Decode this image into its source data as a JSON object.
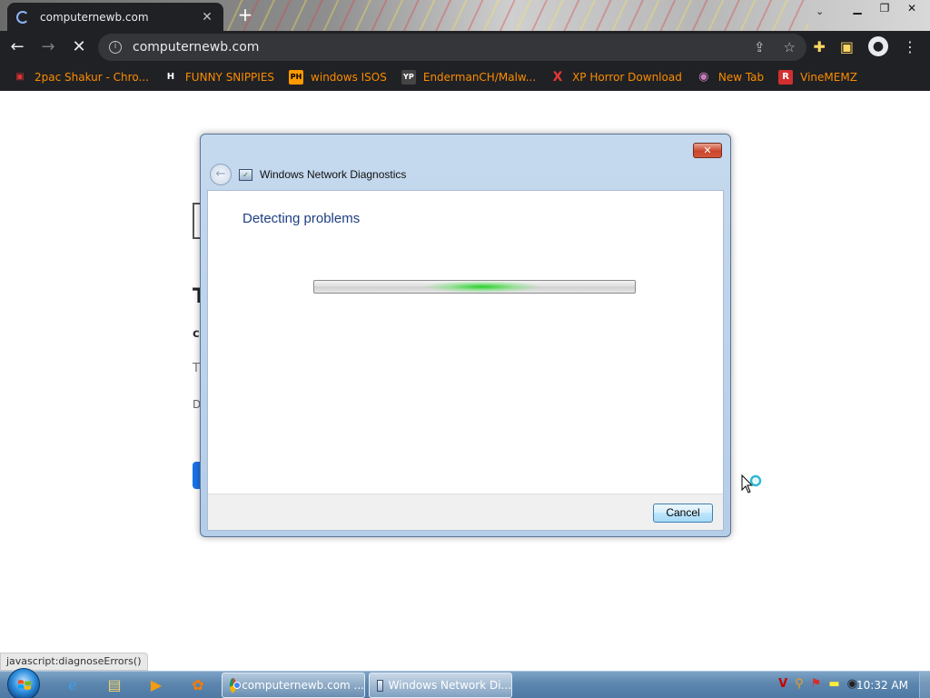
{
  "browser": {
    "tab_title": "computernewb.com",
    "new_tab_symbol": "+",
    "address": "computernewb.com",
    "bookmarks": [
      {
        "label": "2pac Shakur - Chro...",
        "icon": "image-bookmark-icon",
        "fav_text": "▣",
        "fav_color": "#d33"
      },
      {
        "label": "FUNNY SNIPPIES",
        "icon": "h-bookmark-icon",
        "fav_text": "H",
        "fav_color": "#ffffff"
      },
      {
        "label": "windows ISOS",
        "icon": "ph-bookmark-icon",
        "fav_text": "PH",
        "fav_color": "#f90"
      },
      {
        "label": "EndermanCH/Malw...",
        "icon": "yp-bookmark-icon",
        "fav_text": "YP",
        "fav_color": "#555"
      },
      {
        "label": "XP Horror Download",
        "icon": "x-bookmark-icon",
        "fav_text": "X",
        "fav_color": "#e53935"
      },
      {
        "label": "New Tab",
        "icon": "globe-bookmark-icon",
        "fav_text": "◉",
        "fav_color": "#c77dbb"
      },
      {
        "label": "VineMEMZ",
        "icon": "r-bookmark-icon",
        "fav_text": "R",
        "fav_color": "#d32f2f"
      }
    ]
  },
  "dialog": {
    "title": "Windows Network Diagnostics",
    "heading": "Detecting problems",
    "progress_state": "indeterminate",
    "close_symbol": "✕",
    "cancel_label": "Cancel"
  },
  "page_fragments": [
    "T",
    "c",
    "T",
    "D"
  ],
  "status_bar": "javascript:diagnoseErrors()",
  "taskbar": {
    "tasks": [
      {
        "label": "computernewb.com ...",
        "icon": "chrome-icon"
      },
      {
        "label": "Windows Network Di...",
        "icon": "network-diagnostics-icon"
      }
    ],
    "clock": "10:32 AM"
  },
  "colors": {
    "bookmark_text": "#fb8c00",
    "dialog_heading": "#1e3f82",
    "progress_glow": "#28d228"
  }
}
